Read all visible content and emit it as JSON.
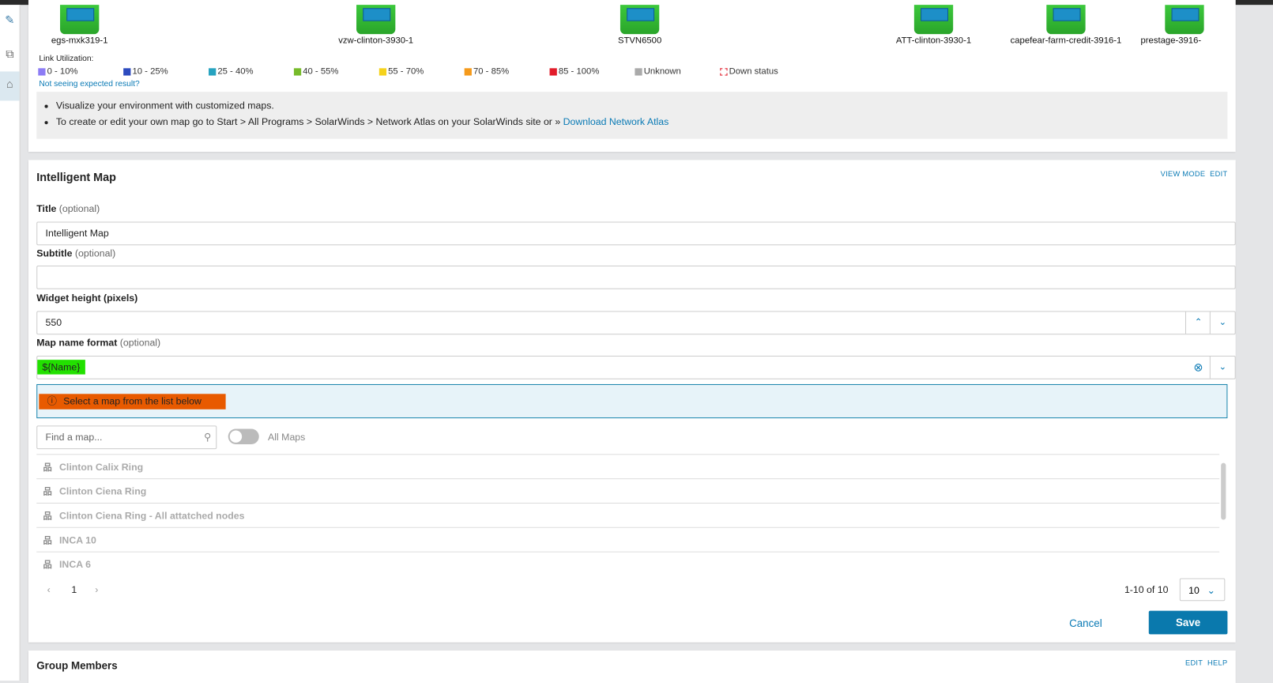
{
  "nodes": [
    {
      "label": "egs-mxk319-1"
    },
    {
      "label": "vzw-clinton-3930-1"
    },
    {
      "label": "STVN6500"
    },
    {
      "label": "ATT-clinton-3930-1"
    },
    {
      "label": "capefear-farm-credit-3916-1"
    },
    {
      "label": "prestage-3916-"
    }
  ],
  "legend": {
    "title": "Link Utilization:",
    "items": [
      {
        "label": "0 - 10%",
        "color": "#8c7cf5"
      },
      {
        "label": "10 - 25%",
        "color": "#2d4bbf"
      },
      {
        "label": "25 - 40%",
        "color": "#26a3c0"
      },
      {
        "label": "40 - 55%",
        "color": "#77bb2a"
      },
      {
        "label": "55 - 70%",
        "color": "#f5d21c"
      },
      {
        "label": "70 - 85%",
        "color": "#f59a1b"
      },
      {
        "label": "85 - 100%",
        "color": "#e21c2a"
      },
      {
        "label": "Unknown",
        "color": "#aaaaaa"
      },
      {
        "label": "Down status",
        "color": "#e21c2a"
      }
    ],
    "help_link": "Not seeing expected result?"
  },
  "info": {
    "line1": "Visualize your environment with customized maps.",
    "line2": "To create or edit your own map go to Start > All Programs > SolarWinds > Network Atlas on your SolarWinds site or »",
    "download_link": "Download Network Atlas"
  },
  "intelligent_map": {
    "title": "Intelligent Map",
    "view_mode": "VIEW MODE",
    "edit": "EDIT",
    "title_label": "Title",
    "optional": "(optional)",
    "title_value": "Intelligent Map",
    "subtitle_label": "Subtitle",
    "subtitle_value": "",
    "height_label": "Widget height (pixels)",
    "height_value": "550",
    "format_label": "Map name format",
    "format_value": "${Name}",
    "alert": "Select a map from the list below",
    "search_placeholder": "Find a map...",
    "all_maps": "All Maps",
    "maps": [
      "Clinton Calix Ring",
      "Clinton Ciena Ring",
      "Clinton Ciena Ring - All attatched nodes",
      "INCA 10",
      "INCA 6"
    ],
    "page": "1",
    "range": "1-10 of 10",
    "page_size": "10",
    "cancel": "Cancel",
    "save": "Save"
  },
  "group_members": {
    "title": "Group Members",
    "edit": "EDIT",
    "help": "HELP"
  }
}
